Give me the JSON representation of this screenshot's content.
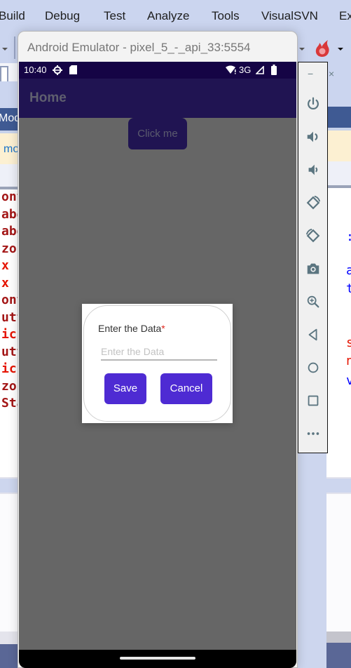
{
  "vs": {
    "menu": [
      "Build",
      "Debug",
      "Test",
      "Analyze",
      "Tools",
      "VisualSVN",
      "Ex"
    ],
    "left_code_fragments": {
      "tab_label": "Mod",
      "info_text": "mo",
      "lines": [
        {
          "text": "ont",
          "color": "#a31515"
        },
        {
          "text": "abe",
          "color": "#a31515"
        },
        {
          "text": "abe",
          "color": "#a31515"
        },
        {
          "text": "zon",
          "color": "#a31515"
        },
        {
          "text": " x",
          "color": "#e51400"
        },
        {
          "text": " x",
          "color": "#e51400"
        },
        {
          "text": "ont",
          "color": "#a31515"
        },
        {
          "text": "utt",
          "color": "#a31515"
        },
        {
          "text": "ick",
          "color": "#e51400"
        },
        {
          "text": "utt",
          "color": "#a31515"
        },
        {
          "text": "ick",
          "color": "#e51400"
        },
        {
          "text": "zon",
          "color": "#a31515"
        },
        {
          "text": "Sta",
          "color": "#a31515"
        }
      ]
    },
    "right_code_fragments": [
      {
        "text": ":",
        "color": "#0000ff"
      },
      {
        "text": "a",
        "color": "#0000ff"
      },
      {
        "text": "t",
        "color": "#0000ff"
      },
      {
        "text": "s",
        "color": "#e51400"
      },
      {
        "text": "n",
        "color": "#e51400"
      },
      {
        "text": "v",
        "color": "#0000ff"
      }
    ]
  },
  "emulator": {
    "window_title": "Android Emulator - pixel_5_-_api_33:5554",
    "status_bar": {
      "time": "10:40",
      "network": "3G",
      "icons": [
        "settings-icon",
        "sd-card-icon",
        "wifi-icon",
        "signal-icon",
        "battery-icon"
      ]
    },
    "app_bar": {
      "title": "Home"
    },
    "click_button": {
      "label": "Click me"
    },
    "dialog": {
      "label": "Enter the Data",
      "required_marker": "*",
      "input": {
        "value": "",
        "placeholder": "Enter the Data"
      },
      "save_label": "Save",
      "cancel_label": "Cancel"
    },
    "side_toolbar": {
      "minimize": "−",
      "close": "×",
      "buttons": [
        {
          "name": "power-icon",
          "label": "Power"
        },
        {
          "name": "volume-up-icon",
          "label": "Volume up"
        },
        {
          "name": "volume-down-icon",
          "label": "Volume down"
        },
        {
          "name": "rotate-left-icon",
          "label": "Rotate left"
        },
        {
          "name": "rotate-right-icon",
          "label": "Rotate right"
        },
        {
          "name": "camera-icon",
          "label": "Take screenshot"
        },
        {
          "name": "zoom-icon",
          "label": "Zoom"
        },
        {
          "name": "back-icon",
          "label": "Back"
        },
        {
          "name": "home-icon",
          "label": "Home"
        },
        {
          "name": "overview-icon",
          "label": "Overview"
        },
        {
          "name": "more-icon",
          "label": "Extended controls"
        }
      ]
    }
  },
  "colors": {
    "accent": "#4e2bd3",
    "app_bar": "#201452",
    "status_bar": "#150445",
    "scrim": "#666666",
    "icon": "#5b7580"
  }
}
